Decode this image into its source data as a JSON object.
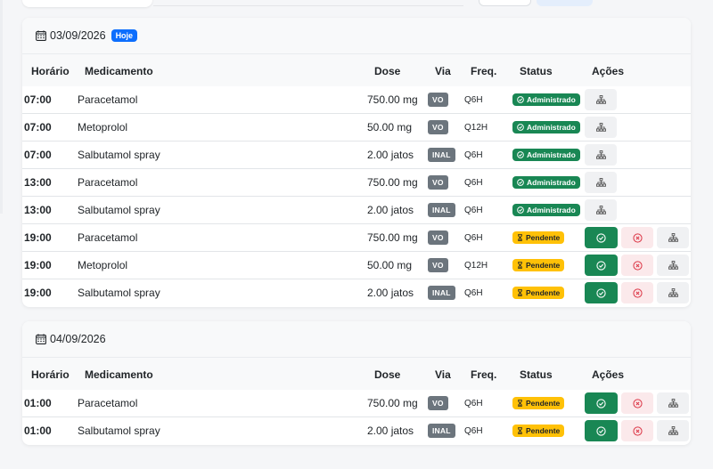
{
  "days": [
    {
      "date": "03/09/2026",
      "today_badge": "Hoje",
      "headers": {
        "time": "Horário",
        "med": "Medicamento",
        "dose": "Dose",
        "via": "Via",
        "freq": "Freq.",
        "status": "Status",
        "actions": "Ações"
      },
      "rows": [
        {
          "time": "07:00",
          "med": "Paracetamol",
          "dose": "750.00 mg",
          "via": "VO",
          "freq": "Q6H",
          "status": "Administrado",
          "state": "done"
        },
        {
          "time": "07:00",
          "med": "Metoprolol",
          "dose": "50.00 mg",
          "via": "VO",
          "freq": "Q12H",
          "status": "Administrado",
          "state": "done"
        },
        {
          "time": "07:00",
          "med": "Salbutamol spray",
          "dose": "2.00 jatos",
          "via": "INAL",
          "freq": "Q6H",
          "status": "Administrado",
          "state": "done"
        },
        {
          "time": "13:00",
          "med": "Paracetamol",
          "dose": "750.00 mg",
          "via": "VO",
          "freq": "Q6H",
          "status": "Administrado",
          "state": "done"
        },
        {
          "time": "13:00",
          "med": "Salbutamol spray",
          "dose": "2.00 jatos",
          "via": "INAL",
          "freq": "Q6H",
          "status": "Administrado",
          "state": "done"
        },
        {
          "time": "19:00",
          "med": "Paracetamol",
          "dose": "750.00 mg",
          "via": "VO",
          "freq": "Q6H",
          "status": "Pendente",
          "state": "pending"
        },
        {
          "time": "19:00",
          "med": "Metoprolol",
          "dose": "50.00 mg",
          "via": "VO",
          "freq": "Q12H",
          "status": "Pendente",
          "state": "pending"
        },
        {
          "time": "19:00",
          "med": "Salbutamol spray",
          "dose": "2.00 jatos",
          "via": "INAL",
          "freq": "Q6H",
          "status": "Pendente",
          "state": "pending"
        }
      ]
    },
    {
      "date": "04/09/2026",
      "today_badge": "",
      "headers": {
        "time": "Horário",
        "med": "Medicamento",
        "dose": "Dose",
        "via": "Via",
        "freq": "Freq.",
        "status": "Status",
        "actions": "Ações"
      },
      "rows": [
        {
          "time": "01:00",
          "med": "Paracetamol",
          "dose": "750.00 mg",
          "via": "VO",
          "freq": "Q6H",
          "status": "Pendente",
          "state": "pending"
        },
        {
          "time": "01:00",
          "med": "Salbutamol spray",
          "dose": "2.00 jatos",
          "via": "INAL",
          "freq": "Q6H",
          "status": "Pendente",
          "state": "pending"
        }
      ]
    }
  ],
  "icons": {
    "calendar": "calendar-icon",
    "check": "check-circle-icon",
    "hourglass": "hourglass-icon",
    "cancel": "x-circle-icon",
    "tree": "diagram-icon"
  },
  "colors": {
    "administered": "#198754",
    "pending": "#ffc107",
    "today": "#0d6efd",
    "route": "#6c757d",
    "cancel_bg": "#fbe9eb",
    "cancel_icon": "#dc3545"
  }
}
